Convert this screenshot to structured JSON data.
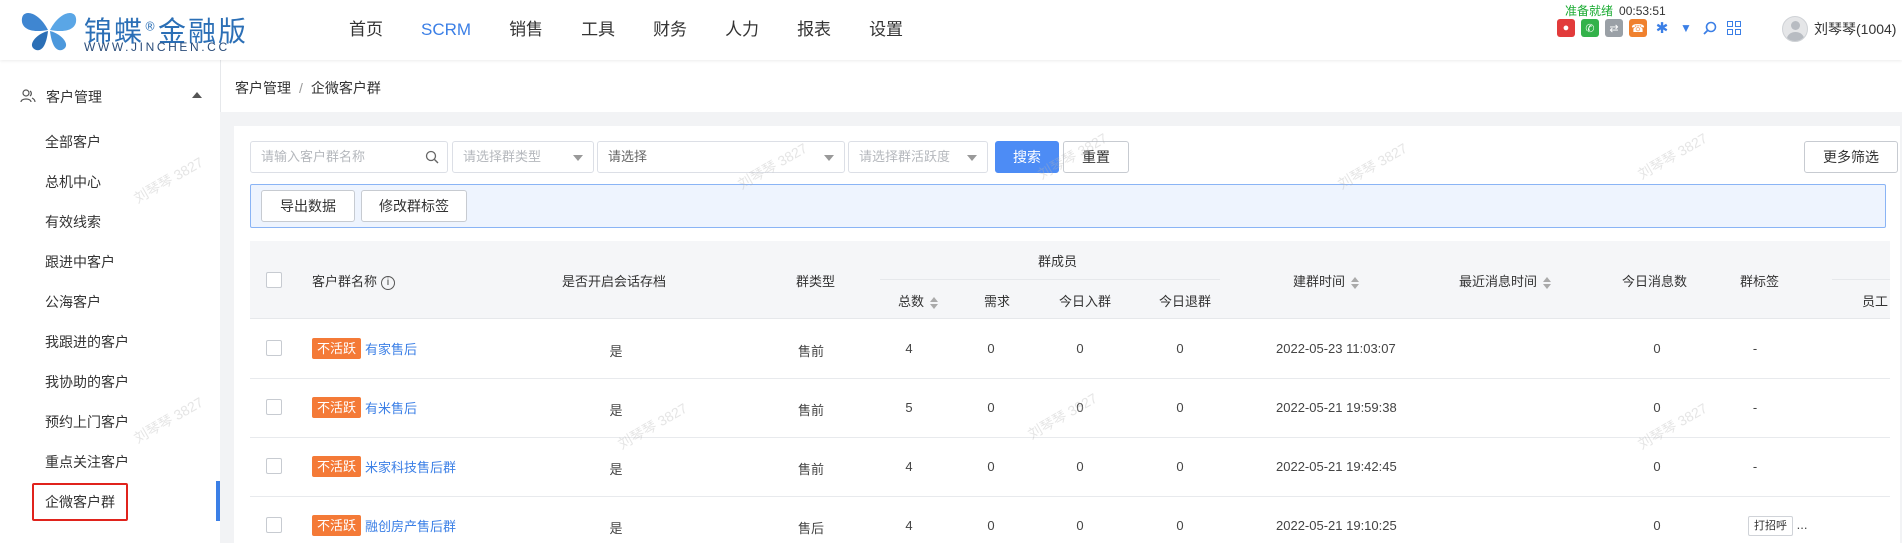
{
  "header": {
    "brand_cn": "锦蝶",
    "brand_reg": "®",
    "brand_suffix": "金融版",
    "domain": "WWW.JINCHEN.CC",
    "nav": [
      "首页",
      "SCRM",
      "销售",
      "工具",
      "财务",
      "人力",
      "报表",
      "设置"
    ],
    "active_nav": "SCRM",
    "status_text": "准备就绪",
    "timer": "00:53:51",
    "user_name": "刘琴琴(1004)"
  },
  "sidebar": {
    "group_label": "客户管理",
    "items": [
      "全部客户",
      "总机中心",
      "有效线索",
      "跟进中客户",
      "公海客户",
      "我跟进的客户",
      "我协助的客户",
      "预约上门客户",
      "重点关注客户",
      "企微客户群"
    ],
    "active_item": "企微客户群"
  },
  "breadcrumb": {
    "parent": "客户管理",
    "separator": "/",
    "current": "企微客户群"
  },
  "filters": {
    "name_placeholder": "请输入客户群名称",
    "type_placeholder": "请选择群类型",
    "select_placeholder": "请选择",
    "activity_placeholder": "请选择群活跃度",
    "search_label": "搜索",
    "reset_label": "重置",
    "more_label": "更多筛选"
  },
  "actions": {
    "export_label": "导出数据",
    "edit_tag_label": "修改群标签"
  },
  "table": {
    "headers": {
      "name": "客户群名称",
      "archive": "是否开启会话存档",
      "type": "群类型",
      "members": "群成员",
      "total": "总数",
      "demand": "需求",
      "joined": "今日入群",
      "left": "今日退群",
      "created": "建群时间",
      "last_msg": "最近消息时间",
      "today_msgs": "今日消息数",
      "tags": "群标签",
      "staff": "员工"
    },
    "rows": [
      {
        "status": "不活跃",
        "name": "有家售后",
        "archive": "是",
        "type": "售前",
        "total": "4",
        "demand": "0",
        "joined": "0",
        "left": "0",
        "created": "2022-05-23 11:03:07",
        "last_msg": "",
        "today_msgs": "0",
        "tags": "-"
      },
      {
        "status": "不活跃",
        "name": "有米售后",
        "archive": "是",
        "type": "售前",
        "total": "5",
        "demand": "0",
        "joined": "0",
        "left": "0",
        "created": "2022-05-21 19:59:38",
        "last_msg": "",
        "today_msgs": "0",
        "tags": "-"
      },
      {
        "status": "不活跃",
        "name": "米家科技售后群",
        "archive": "是",
        "type": "售前",
        "total": "4",
        "demand": "0",
        "joined": "0",
        "left": "0",
        "created": "2022-05-21 19:42:45",
        "last_msg": "",
        "today_msgs": "0",
        "tags": "-"
      },
      {
        "status": "不活跃",
        "name": "融创房产售后群",
        "archive": "是",
        "type": "售后",
        "total": "4",
        "demand": "0",
        "joined": "0",
        "left": "0",
        "created": "2022-05-21 19:10:25",
        "last_msg": "",
        "today_msgs": "0",
        "tags": "打招呼",
        "tags_more": "..."
      }
    ]
  },
  "watermark": "刘琴琴 3827",
  "colors": {
    "accent": "#3b7fe6",
    "inactive_tag": "#f47a37",
    "status_ok": "#1aab32",
    "highlight_box": "#e0231c"
  }
}
